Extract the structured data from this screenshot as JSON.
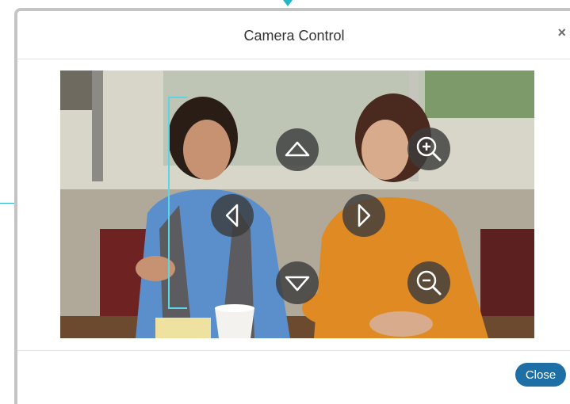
{
  "dialog": {
    "title": "Camera Control",
    "close_icon": "close-icon",
    "close_symbol": "×",
    "close_button_label": "Close"
  },
  "camera": {
    "controls": [
      {
        "name": "pan-up",
        "icon": "triangle-up-icon"
      },
      {
        "name": "pan-left",
        "icon": "chevron-left-icon"
      },
      {
        "name": "pan-right",
        "icon": "chevron-right-icon"
      },
      {
        "name": "pan-down",
        "icon": "triangle-down-icon"
      },
      {
        "name": "zoom-in",
        "icon": "zoom-in-icon"
      },
      {
        "name": "zoom-out",
        "icon": "zoom-out-icon"
      }
    ]
  },
  "colors": {
    "accent": "#22b8c8",
    "close_button": "#1d6fa6",
    "control_background": "#3c3c3c"
  }
}
